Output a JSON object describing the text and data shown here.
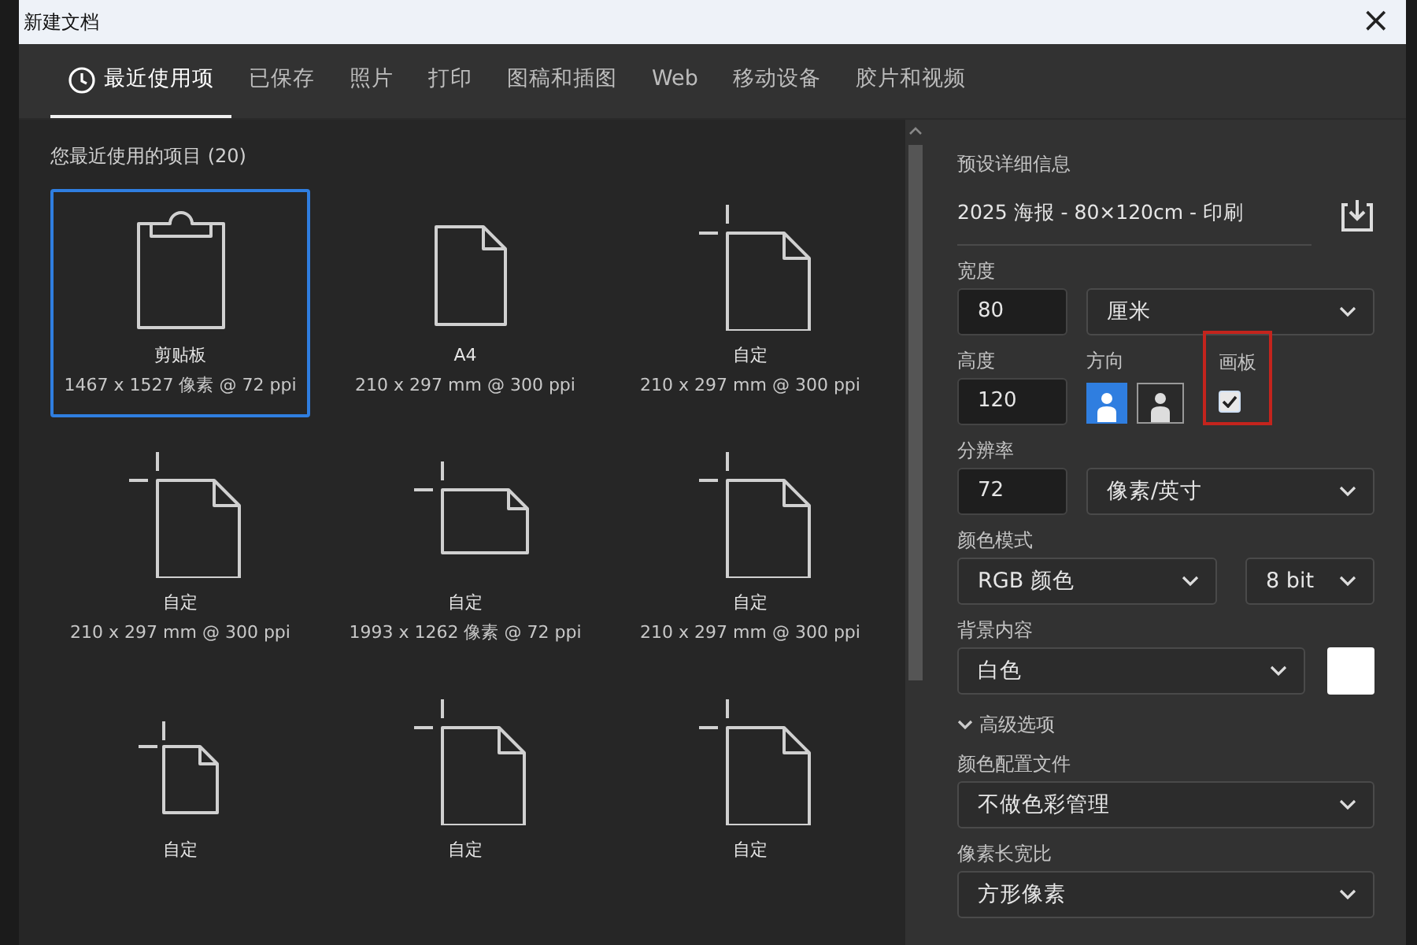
{
  "window": {
    "title": "新建文档",
    "close": "×"
  },
  "tabs": [
    {
      "label": "最近使用项",
      "selected": true,
      "kind": "recent"
    },
    {
      "label": "已保存",
      "selected": false,
      "kind": "text"
    },
    {
      "label": "照片",
      "selected": false,
      "kind": "text"
    },
    {
      "label": "打印",
      "selected": false,
      "kind": "text"
    },
    {
      "label": "图稿和插图",
      "selected": false,
      "kind": "text"
    },
    {
      "label": "Web",
      "selected": false,
      "kind": "text"
    },
    {
      "label": "移动设备",
      "selected": false,
      "kind": "text"
    },
    {
      "label": "胶片和视频",
      "selected": false,
      "kind": "text"
    }
  ],
  "recent": {
    "heading": "您最近使用的项目 (20)",
    "items": [
      {
        "name": "剪贴板",
        "size": "1467 x 1527 像素 @ 72 ppi",
        "selected": true,
        "kind": "clipboard"
      },
      {
        "name": "A4",
        "size": "210 x 297 mm @ 300 ppi",
        "selected": false,
        "kind": "document"
      },
      {
        "name": "自定",
        "size": "210 x 297 mm @ 300 ppi",
        "selected": false,
        "kind": "custom"
      },
      {
        "name": "自定",
        "size": "210 x 297 mm @ 300 ppi",
        "selected": false,
        "kind": "custom"
      },
      {
        "name": "自定",
        "size": "1993 x 1262 像素 @ 72 ppi",
        "selected": false,
        "kind": "custom-wide"
      },
      {
        "name": "自定",
        "size": "210 x 297 mm @ 300 ppi",
        "selected": false,
        "kind": "custom"
      },
      {
        "name": "自定",
        "selected": false,
        "kind": "custom-small"
      },
      {
        "name": "自定",
        "selected": false,
        "kind": "custom"
      },
      {
        "name": "自定",
        "selected": false,
        "kind": "custom"
      }
    ]
  },
  "details": {
    "heading": "预设详细信息",
    "preset_name": "2025 海报 - 80×120cm - 印刷",
    "width": {
      "label": "宽度",
      "value": "80",
      "unit": "厘米"
    },
    "height": {
      "label": "高度",
      "value": "120"
    },
    "orientation": {
      "label": "方向",
      "options": [
        {
          "kind": "portrait",
          "selected": true
        },
        {
          "kind": "landscape",
          "selected": false
        }
      ]
    },
    "artboard": {
      "label": "画板",
      "checked": true,
      "highlighted": true
    },
    "resolution": {
      "label": "分辨率",
      "value": "72",
      "unit": "像素/英寸"
    },
    "color_mode": {
      "label": "颜色模式",
      "mode": "RGB 颜色",
      "depth": "8 bit"
    },
    "background": {
      "label": "背景内容",
      "value": "白色"
    },
    "advanced": {
      "label": "高级选项",
      "expanded": true
    },
    "color_profile": {
      "label": "颜色配置文件",
      "value": "不做色彩管理"
    },
    "pixel_aspect": {
      "label": "像素长宽比",
      "value": "方形像素"
    }
  }
}
